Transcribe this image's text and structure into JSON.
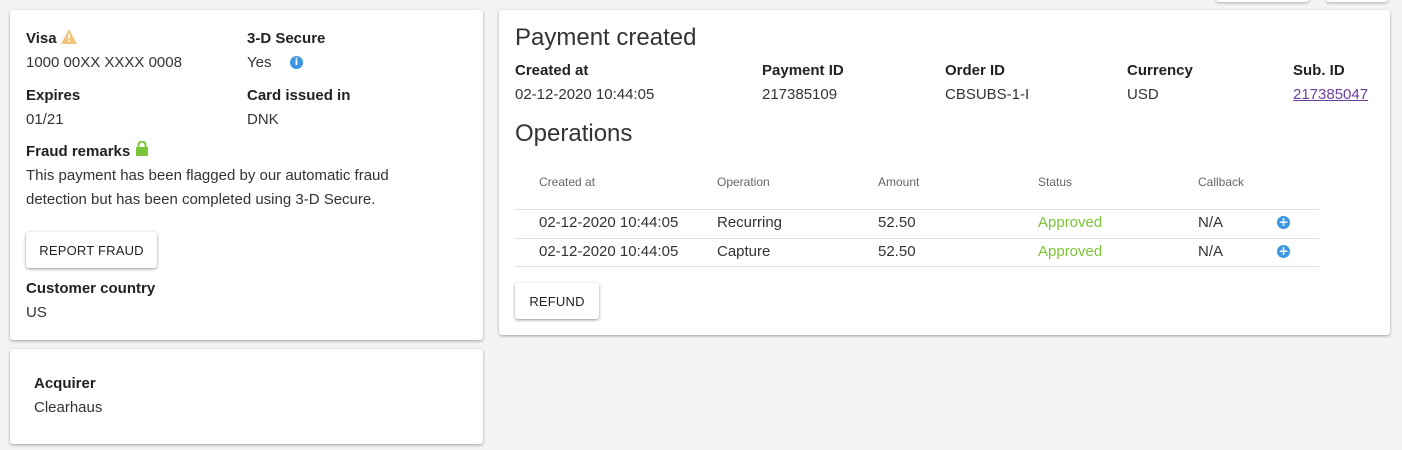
{
  "card_info": {
    "brand_label": "Visa",
    "card_number": "1000 00XX XXXX 0008",
    "secure_label": "3-D Secure",
    "secure_value": "Yes",
    "expires_label": "Expires",
    "expires_value": "01/21",
    "issued_label": "Card issued in",
    "issued_value": "DNK",
    "fraud_label": "Fraud remarks",
    "fraud_text": "This payment has been flagged by our automatic fraud detection but has been completed using 3-D Secure.",
    "report_button": "Report fraud",
    "country_label": "Customer country",
    "country_value": "US"
  },
  "acquirer": {
    "label": "Acquirer",
    "value": "Clearhaus"
  },
  "payment": {
    "title": "Payment created",
    "fields": [
      {
        "label": "Created at",
        "value": "02-12-2020 10:44:05"
      },
      {
        "label": "Payment ID",
        "value": "217385109"
      },
      {
        "label": "Order ID",
        "value": "CBSUBS-1-I"
      },
      {
        "label": "Currency",
        "value": "USD"
      },
      {
        "label": "Sub. ID",
        "value": "217385047"
      }
    ]
  },
  "operations": {
    "title": "Operations",
    "columns": [
      "Created at",
      "Operation",
      "Amount",
      "Status",
      "Callback"
    ],
    "rows": [
      {
        "created": "02-12-2020 10:44:05",
        "operation": "Recurring",
        "amount": "52.50",
        "status": "Approved",
        "callback": "N/A"
      },
      {
        "created": "02-12-2020 10:44:05",
        "operation": "Capture",
        "amount": "52.50",
        "status": "Approved",
        "callback": "N/A"
      }
    ],
    "refund_button": "Refund"
  },
  "colors": {
    "approved": "#7cc43a",
    "info_blue": "#3d97e0",
    "warning": "#f0b429",
    "lock_green": "#7cc43a",
    "link": "#6b3fa0"
  },
  "icons": {
    "warning": "warning-triangle-icon",
    "info": "info-icon",
    "lock": "lock-icon",
    "expand": "plus-circle-icon"
  }
}
